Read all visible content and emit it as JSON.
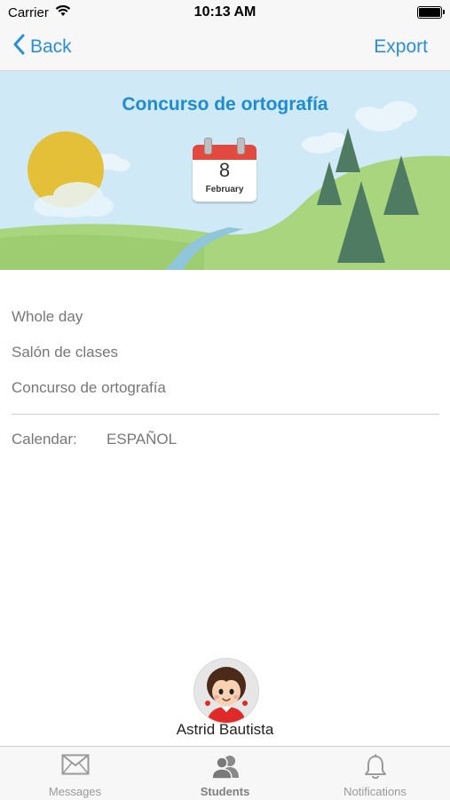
{
  "status_bar": {
    "carrier": "Carrier",
    "time": "10:13 AM",
    "wifi_icon": "wifi-icon",
    "battery_icon": "battery-icon"
  },
  "nav": {
    "back_label": "Back",
    "export_label": "Export"
  },
  "banner": {
    "title": "Concurso de ortografía",
    "calendar": {
      "day": "8",
      "month": "February"
    }
  },
  "event": {
    "lines": [
      "Whole day",
      "Salón de clases",
      "Concurso de ortografía"
    ],
    "calendar_label": "Calendar:",
    "calendar_value": "ESPAÑOL"
  },
  "student": {
    "name": "Astrid Bautista"
  },
  "tabs": [
    {
      "label": "Messages",
      "icon": "envelope-icon",
      "active": false
    },
    {
      "label": "Students",
      "icon": "students-icon",
      "active": true
    },
    {
      "label": "Notifications",
      "icon": "bell-icon",
      "active": false
    }
  ],
  "colors": {
    "accent": "#2a8fd7",
    "title": "#1e8ccf",
    "sky": "#cfe9f6",
    "grass": "#a7d27a",
    "tree": "#4f7b62",
    "sun": "#e3c038",
    "calendar_red": "#e24a40"
  }
}
